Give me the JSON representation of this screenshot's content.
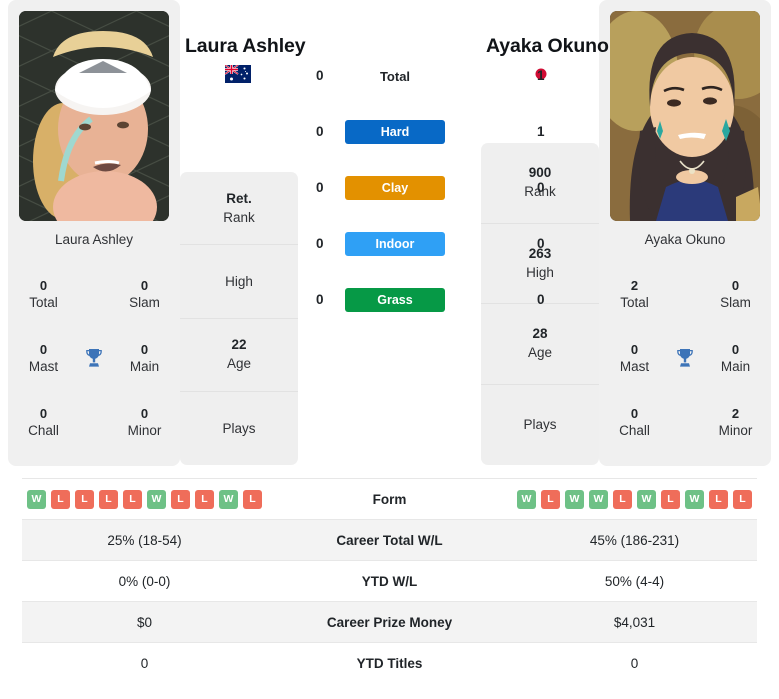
{
  "players": [
    {
      "name": "Laura Ashley",
      "caption": "Laura Ashley",
      "flag": "australia-flag",
      "flag_colors": {
        "field": "#012169",
        "cross": "#ffffff",
        "stripe": "#e4002b",
        "star": "#ffffff"
      },
      "titles": [
        {
          "value": "0",
          "label": "Total"
        },
        {
          "value": "0",
          "label": "Slam"
        },
        {
          "value": "0",
          "label": "Mast"
        },
        {
          "value": "0",
          "label": "Main"
        },
        {
          "value": "0",
          "label": "Chall"
        },
        {
          "value": "0",
          "label": "Minor"
        }
      ],
      "ranks": [
        {
          "value": "Ret.",
          "label": "Rank"
        },
        {
          "value": "",
          "label": "High"
        },
        {
          "value": "22",
          "label": "Age"
        },
        {
          "value": "",
          "label": "Plays"
        }
      ]
    },
    {
      "name": "Ayaka Okuno",
      "caption": "Ayaka Okuno",
      "flag": "japan-flag",
      "flag_colors": {
        "field": "#ffffff",
        "disc": "#d00c34"
      },
      "titles": [
        {
          "value": "2",
          "label": "Total"
        },
        {
          "value": "0",
          "label": "Slam"
        },
        {
          "value": "0",
          "label": "Mast"
        },
        {
          "value": "0",
          "label": "Main"
        },
        {
          "value": "0",
          "label": "Chall"
        },
        {
          "value": "2",
          "label": "Minor"
        }
      ],
      "ranks": [
        {
          "value": "900",
          "label": "Rank"
        },
        {
          "value": "263",
          "label": "High"
        },
        {
          "value": "28",
          "label": "Age"
        },
        {
          "value": "",
          "label": "Plays"
        }
      ]
    }
  ],
  "surfaces": [
    {
      "label": "Total",
      "left": "0",
      "right": "1",
      "color": "",
      "styled": false
    },
    {
      "label": "Hard",
      "left": "0",
      "right": "1",
      "color": "#0869c6",
      "styled": true
    },
    {
      "label": "Clay",
      "left": "0",
      "right": "0",
      "color": "#e39100",
      "styled": true
    },
    {
      "label": "Indoor",
      "left": "0",
      "right": "0",
      "color": "#2fa0f5",
      "styled": true
    },
    {
      "label": "Grass",
      "left": "0",
      "right": "0",
      "color": "#069946",
      "styled": true
    }
  ],
  "table": {
    "form_label": "Form",
    "form_left": [
      "W",
      "L",
      "L",
      "L",
      "L",
      "W",
      "L",
      "L",
      "W",
      "L"
    ],
    "form_right": [
      "W",
      "L",
      "W",
      "W",
      "L",
      "W",
      "L",
      "W",
      "L",
      "L"
    ],
    "rows": [
      {
        "left": "25% (18-54)",
        "label": "Career Total W/L",
        "right": "45% (186-231)"
      },
      {
        "left": "0% (0-0)",
        "label": "YTD W/L",
        "right": "50% (4-4)"
      },
      {
        "left": "$0",
        "label": "Career Prize Money",
        "right": "$4,031"
      },
      {
        "left": "0",
        "label": "YTD Titles",
        "right": "0"
      }
    ]
  },
  "icons": {
    "trophy": "trophy-icon",
    "trophy_color": "#3d74b8"
  }
}
